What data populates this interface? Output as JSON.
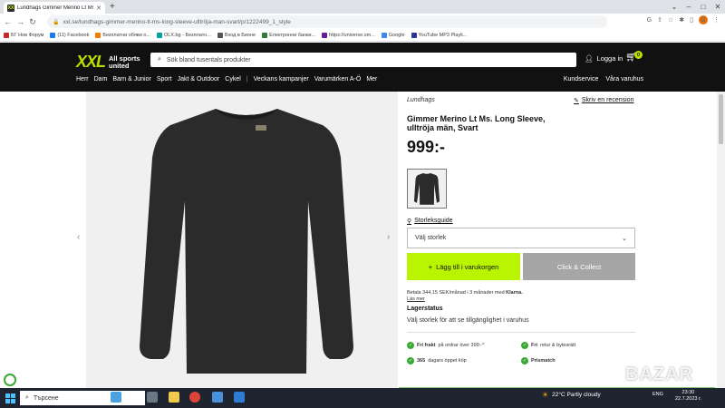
{
  "browser": {
    "tab_title": "Lundhags Gimmer Merino Lt Ms",
    "url": "xxl.se/lundhags-gimmer-merino-lt-ms-long-sleeve-ulltröja-man-svart/p/1222499_1_style",
    "bookmarks": [
      {
        "label": "БГ Нов Форум",
        "color": "#c62828"
      },
      {
        "label": "(11) Facebook",
        "color": "#1877f2"
      },
      {
        "label": "Безплатни обяви о...",
        "color": "#f57c00"
      },
      {
        "label": "OLX.bg - Безплатн...",
        "color": "#00a49f"
      },
      {
        "label": "Вход в Бионе",
        "color": "#555555"
      },
      {
        "label": "Електронни банки...",
        "color": "#2e7d32"
      },
      {
        "label": "https://universe.sm...",
        "color": "#6a1b9a"
      },
      {
        "label": "Google",
        "color": "#4285f4"
      },
      {
        "label": "YouTube MP3 Playli...",
        "color": "#283593"
      }
    ]
  },
  "header": {
    "logo_big": "XXL",
    "logo_small": "All sports united",
    "search_placeholder": "Sök bland tusentals produkter",
    "login_label": "Logga in",
    "cart_count": "0",
    "categories": [
      "Herr",
      "Dam",
      "Barn & Junior",
      "Sport",
      "Jakt & Outdoor",
      "Cykel",
      "|",
      "Veckans kampanjer",
      "Varumärken A-Ö",
      "Mer"
    ],
    "help_links": [
      "Kundservice",
      "Våra varuhus"
    ]
  },
  "product": {
    "brand": "Lundhags",
    "review_link": "Skriv en recension",
    "title": "Gimmer Merino Lt Ms. Long Sleeve, ulltröja män, Svart",
    "price": "999:-",
    "size_guide": "Storleksguide",
    "size_select": "Välj storlek",
    "add_to_cart": "Lägg till i varukorgen",
    "click_collect": "Click & Collect",
    "klarna_text": "Betala 344,15 SEK/månad i 3 månader med",
    "klarna_brand": "Klarna.",
    "read_more": "Läs mer",
    "stock_heading": "Lagerstatus",
    "stock_text": "Välj storlek för att se tillgänglighet i varuhus",
    "usps": [
      {
        "bold": "Fri frakt",
        "text": " på ordrar över 399:-*"
      },
      {
        "bold": "Fri",
        "text": " retur & bytesrätt"
      },
      {
        "bold": "365",
        "text": " dagars öppet köp"
      },
      {
        "bold": "Prismatch",
        "text": ""
      }
    ]
  },
  "taskbar": {
    "search_placeholder": "Търсене",
    "weather": "22°C  Partly cloudy",
    "lang": "ENG",
    "time": "23:30",
    "date": "22.7.2023 г."
  },
  "watermark": "BAZAR"
}
